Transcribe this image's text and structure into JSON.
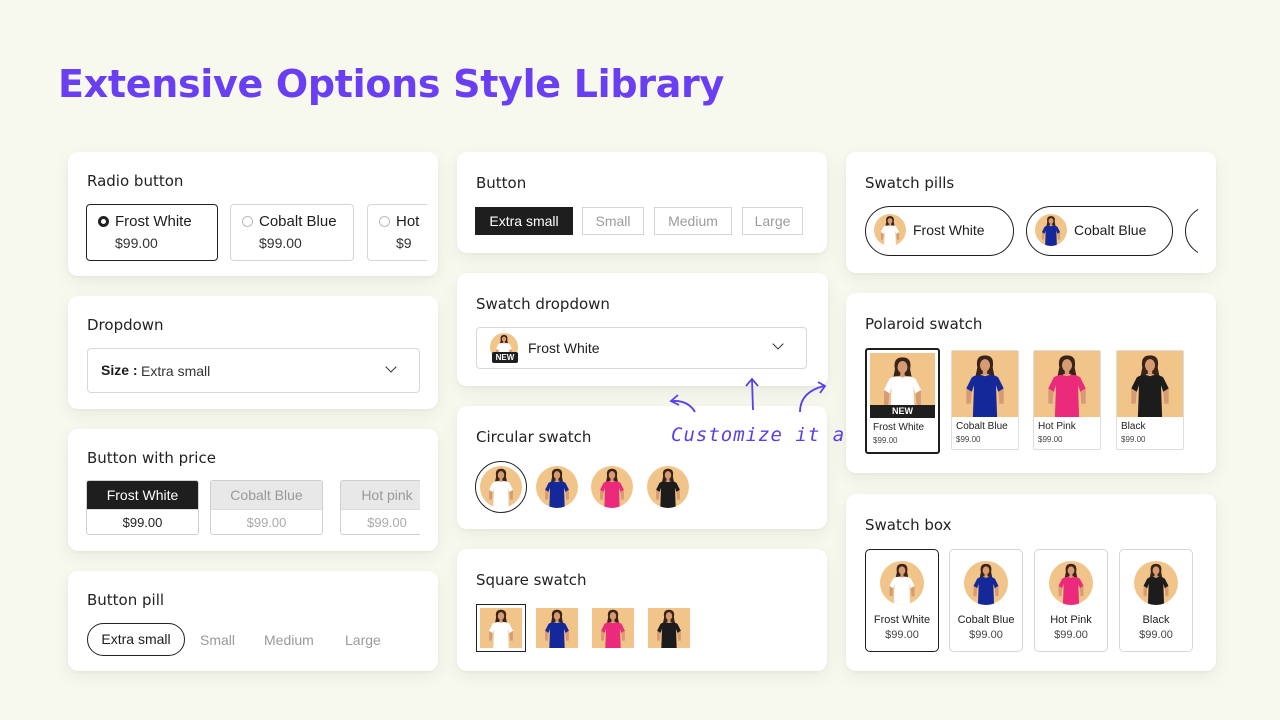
{
  "title": "Extensive Options Style Library",
  "accent_color": "#6a3ef2",
  "annotation": "Customize it all",
  "radio": {
    "title": "Radio button",
    "options": [
      {
        "name": "Frost White",
        "price": "$99.00"
      },
      {
        "name": "Cobalt Blue",
        "price": "$99.00"
      },
      {
        "name": "Hot",
        "price": "$9"
      }
    ]
  },
  "dropdown": {
    "title": "Dropdown",
    "label": "Size :",
    "value": "Extra small"
  },
  "button_price": {
    "title": "Button with price",
    "options": [
      {
        "name": "Frost White",
        "price": "$99.00"
      },
      {
        "name": "Cobalt Blue",
        "price": "$99.00"
      },
      {
        "name": "Hot pink",
        "price": "$99.00"
      }
    ]
  },
  "button_pill": {
    "title": "Button pill",
    "options": [
      "Extra small",
      "Small",
      "Medium",
      "Large"
    ]
  },
  "button": {
    "title": "Button",
    "options": [
      "Extra small",
      "Small",
      "Medium",
      "Large"
    ]
  },
  "swatch_dropdown": {
    "title": "Swatch dropdown",
    "value": "Frost White",
    "badge": "NEW"
  },
  "circular_swatch": {
    "title": "Circular swatch"
  },
  "square_swatch": {
    "title": "Square swatch"
  },
  "swatch_pills": {
    "title": "Swatch pills",
    "options": [
      "Frost White",
      "Cobalt Blue"
    ]
  },
  "polaroid": {
    "title": "Polaroid swatch",
    "badge": "NEW",
    "items": [
      {
        "name": "Frost White",
        "price": "$99.00"
      },
      {
        "name": "Cobalt Blue",
        "price": "$99.00"
      },
      {
        "name": "Hot Pink",
        "price": "$99.00"
      },
      {
        "name": "Black",
        "price": "$99.00"
      }
    ]
  },
  "swatch_box": {
    "title": "Swatch box",
    "items": [
      {
        "name": "Frost White",
        "price": "$99.00"
      },
      {
        "name": "Cobalt Blue",
        "price": "$99.00"
      },
      {
        "name": "Hot Pink",
        "price": "$99.00"
      },
      {
        "name": "Black",
        "price": "$99.00"
      }
    ]
  },
  "dress_colors": {
    "white": "#ffffff",
    "blue": "#15289a",
    "pink": "#ec2a7c",
    "black": "#1c1c1c"
  },
  "photo_bg": "#f1c48a"
}
